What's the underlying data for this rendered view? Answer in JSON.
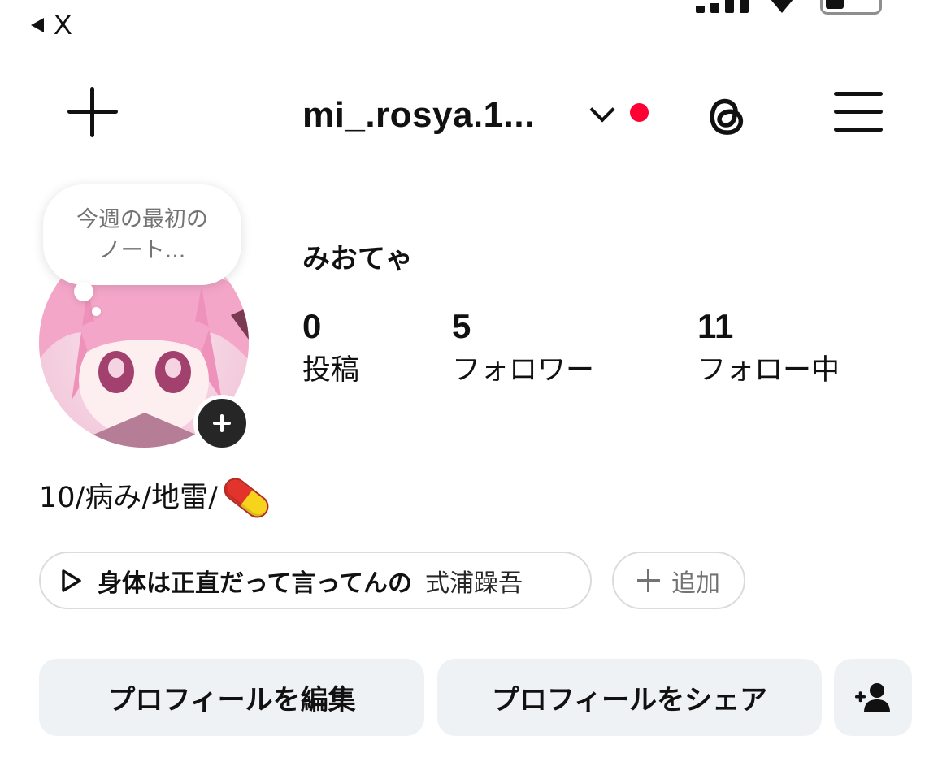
{
  "status_bar": {
    "back_label": "X"
  },
  "header": {
    "username": "mi_.rosya.1..."
  },
  "note": {
    "line1": "今週の最初の",
    "line2": "ノート..."
  },
  "profile": {
    "display_name": "みおてゃ",
    "stats": [
      {
        "value": "0",
        "label": "投稿"
      },
      {
        "value": "5",
        "label": "フォロワー"
      },
      {
        "value": "11",
        "label": "フォロー中"
      }
    ],
    "bio": "10/病み/地雷/"
  },
  "music": {
    "title": "身体は正直だって言ってんの",
    "artist": "式浦躁吾"
  },
  "add_chip": {
    "label": "追加"
  },
  "buttons": {
    "edit": "プロフィールを編集",
    "share": "プロフィールをシェア"
  },
  "colors": {
    "notification_dot": "#ff0034",
    "button_bg": "#eff2f5",
    "note_text": "#737373"
  },
  "icons": [
    "back-arrow-icon",
    "signal-icon",
    "wifi-icon",
    "battery-icon",
    "plus-icon",
    "chevron-down-icon",
    "threads-icon",
    "menu-icon",
    "play-icon",
    "pill-emoji",
    "add-person-icon"
  ]
}
